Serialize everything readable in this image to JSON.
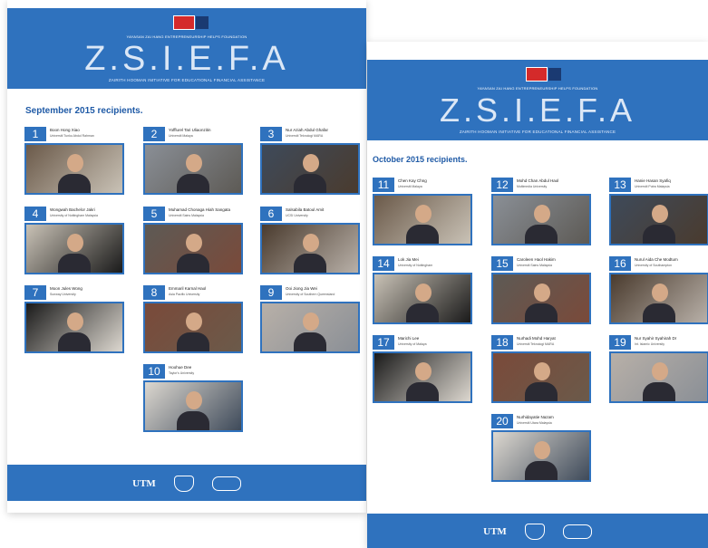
{
  "poster1": {
    "subtitle_top": "YAYASAN ZAI HANG ENTREPRENEURSHIP HELPS FOUNDATION",
    "title": "Z.S.I.E.F.A",
    "tagline": "ZAIRITH HOOMAN INITIATIVE FOR EDUCATIONAL FINANCIAL ASSISTANCE",
    "section": "September 2015 recipients.",
    "cards": [
      {
        "num": "1",
        "name": "Boon Hong Xiao",
        "org": "Universiti Tunku Abdul Rahman"
      },
      {
        "num": "2",
        "name": "Yofflurel Tari Uliaonzitin",
        "org": "Universiti Malaya"
      },
      {
        "num": "3",
        "name": "Nur Aziah Abdul Ghafar",
        "org": "Universiti Teknologi MARA"
      },
      {
        "num": "4",
        "name": "Wongwah Bachelor Jakri",
        "org": "University of Nottingham Malaysia"
      },
      {
        "num": "5",
        "name": "Muhamad Chonaga Hiah Sangata",
        "org": "Universiti Sains Malaysia"
      },
      {
        "num": "6",
        "name": "Salsabila Batoul Amit",
        "org": "UCSI University"
      },
      {
        "num": "7",
        "name": "Moon Jules Wong",
        "org": "Sunway University"
      },
      {
        "num": "8",
        "name": "Emmaril Karnal Haol",
        "org": "Asia Pacific University"
      },
      {
        "num": "9",
        "name": "Ooi Jiong Jia Wei",
        "org": "University of Southern Queensland"
      },
      {
        "num": "10",
        "name": "Hoohue Dee",
        "org": "Taylor's University"
      }
    ],
    "footer": {
      "utm": "UTM"
    }
  },
  "poster2": {
    "subtitle_top": "YAYASAN ZAI HANG ENTREPRENEURSHIP HELPS FOUNDATION",
    "title": "Z.S.I.E.F.A",
    "tagline": "ZAIRITH HOOMAN INITIATIVE FOR EDUCATIONAL FINANCIAL ASSISTANCE",
    "section": "October 2015 recipients.",
    "cards": [
      {
        "num": "11",
        "name": "Chen Kay Chng",
        "org": "Universiti Malaya"
      },
      {
        "num": "12",
        "name": "Mohd Chan Abdul Haol",
        "org": "Multimedia University"
      },
      {
        "num": "13",
        "name": "Hanie Hasan Syafiq",
        "org": "Universiti Putra Malaysia"
      },
      {
        "num": "14",
        "name": "Lok Jia Mei",
        "org": "University of Nottingham"
      },
      {
        "num": "15",
        "name": "Caroleen Haol Hakim",
        "org": "Universiti Sains Malaysia"
      },
      {
        "num": "16",
        "name": "Nurul Aida Che Modtum",
        "org": "University of Southampton"
      },
      {
        "num": "17",
        "name": "Marichi Lee",
        "org": "University of Malaya"
      },
      {
        "num": "18",
        "name": "Nurhadi Mohd Haryat",
        "org": "Universiti Teknologi MARA"
      },
      {
        "num": "19",
        "name": "Nur Syahir Syahirah Dr",
        "org": "Int. Islamic University"
      },
      {
        "num": "20",
        "name": "Nurhidayatie Nazam",
        "org": "Universiti Utara Malaysia"
      }
    ],
    "footer": {
      "utm": "UTM"
    }
  }
}
